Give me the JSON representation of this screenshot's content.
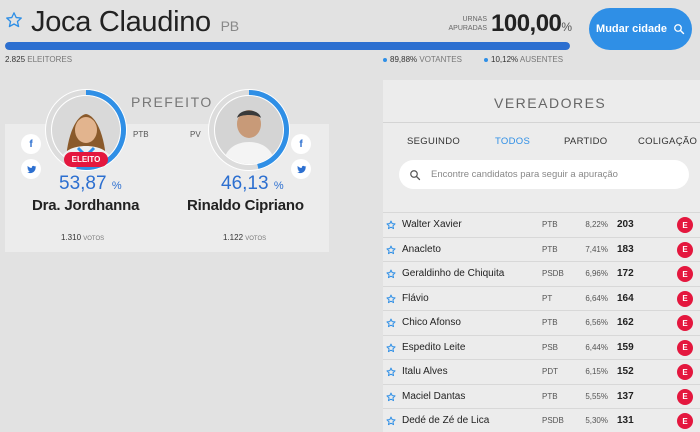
{
  "header": {
    "city": "Joca Claudino",
    "state": "PB",
    "urnas_label_1": "URNAS",
    "urnas_label_2": "APURADAS",
    "urnas_value": "100,00",
    "urnas_unit": "%",
    "urnas_progress_percent": 100,
    "change_city_label": "Mudar cidade"
  },
  "stats": {
    "eleitores_value": "2.825",
    "eleitores_label": "ELEITORES",
    "votantes_value": "89,88%",
    "votantes_label": "VOTANTES",
    "ausentes_value": "10,12%",
    "ausentes_label": "AUSENTES"
  },
  "prefeito": {
    "title": "PREFEITO",
    "elected_label": "ELEITO",
    "candidates": [
      {
        "name": "Dra. Jordhanna",
        "party": "PTB",
        "pct": "53,87",
        "pct_unit": "%",
        "ring_percent": 53.87,
        "votes": "1.310",
        "votes_label": "VOTOS"
      },
      {
        "name": "Rinaldo Cipriano",
        "party": "PV",
        "pct": "46,13",
        "pct_unit": "%",
        "ring_percent": 46.13,
        "votes": "1.122",
        "votes_label": "VOTOS"
      }
    ]
  },
  "vereadores": {
    "title": "VEREADORES",
    "tabs": [
      "SEGUINDO",
      "TODOS",
      "PARTIDO",
      "COLIGAÇÃO"
    ],
    "active_tab": "TODOS",
    "search_placeholder": "Encontre candidatos para seguir a apuração",
    "elected_mark": "E",
    "rows": [
      {
        "name": "Walter Xavier",
        "party": "PTB",
        "pct": "8,22%",
        "votes": "203"
      },
      {
        "name": "Anacleto",
        "party": "PTB",
        "pct": "7,41%",
        "votes": "183"
      },
      {
        "name": "Geraldinho de Chiquita",
        "party": "PSDB",
        "pct": "6,96%",
        "votes": "172"
      },
      {
        "name": "Flávio",
        "party": "PT",
        "pct": "6,64%",
        "votes": "164"
      },
      {
        "name": "Chico Afonso",
        "party": "PTB",
        "pct": "6,56%",
        "votes": "162"
      },
      {
        "name": "Espedito Leite",
        "party": "PSB",
        "pct": "6,44%",
        "votes": "159"
      },
      {
        "name": "Italu Alves",
        "party": "PDT",
        "pct": "6,15%",
        "votes": "152"
      },
      {
        "name": "Maciel Dantas",
        "party": "PTB",
        "pct": "5,55%",
        "votes": "137"
      },
      {
        "name": "Dedé de Zé de Lica",
        "party": "PSDB",
        "pct": "5,30%",
        "votes": "131"
      }
    ]
  },
  "colors": {
    "accent": "#2f8fe6",
    "dark_blue": "#2c6fd0",
    "elected_red": "#e4173e",
    "background": "#e2e2e2",
    "panel": "#ececec"
  },
  "icons": {
    "favorite": "star-outline-icon",
    "search": "search-icon",
    "facebook": "facebook-icon",
    "twitter": "twitter-icon"
  }
}
